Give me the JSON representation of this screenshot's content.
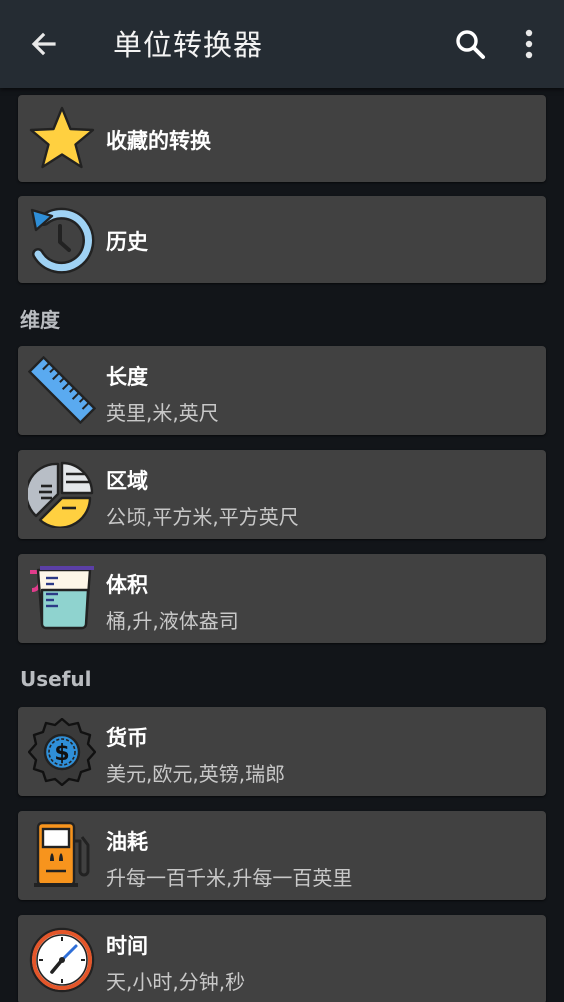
{
  "appbar": {
    "title": "单位转换器"
  },
  "items": {
    "favorites": {
      "label": "收藏的转换"
    },
    "history": {
      "label": "历史"
    }
  },
  "sections": {
    "dimension": "维度",
    "useful": "Useful"
  },
  "cards": {
    "length": {
      "title": "长度",
      "subtitle": "英里,米,英尺"
    },
    "area": {
      "title": "区域",
      "subtitle": "公顷,平方米,平方英尺"
    },
    "volume": {
      "title": "体积",
      "subtitle": "桶,升,液体盎司"
    },
    "currency": {
      "title": "货币",
      "subtitle": "美元,欧元,英镑,瑞郎"
    },
    "fuel": {
      "title": "油耗",
      "subtitle": "升每一百千米,升每一百英里"
    },
    "time": {
      "title": "时间",
      "subtitle": "天,小时,分钟,秒"
    }
  },
  "icons": {
    "back": "arrow-back-icon",
    "search": "search-icon",
    "more": "more-vert-icon",
    "favorites": "star-icon",
    "history": "history-clock-icon",
    "length": "ruler-icon",
    "area": "pie-chart-icon",
    "volume": "measuring-cup-icon",
    "currency": "dollar-badge-icon",
    "fuel": "fuel-pump-icon",
    "time": "clock-icon"
  },
  "colors": {
    "background": "#121519",
    "appbar": "#252c33",
    "card": "#414141",
    "accent_blue": "#2f8fd8",
    "star": "#ffd040",
    "pump": "#f7941d"
  }
}
